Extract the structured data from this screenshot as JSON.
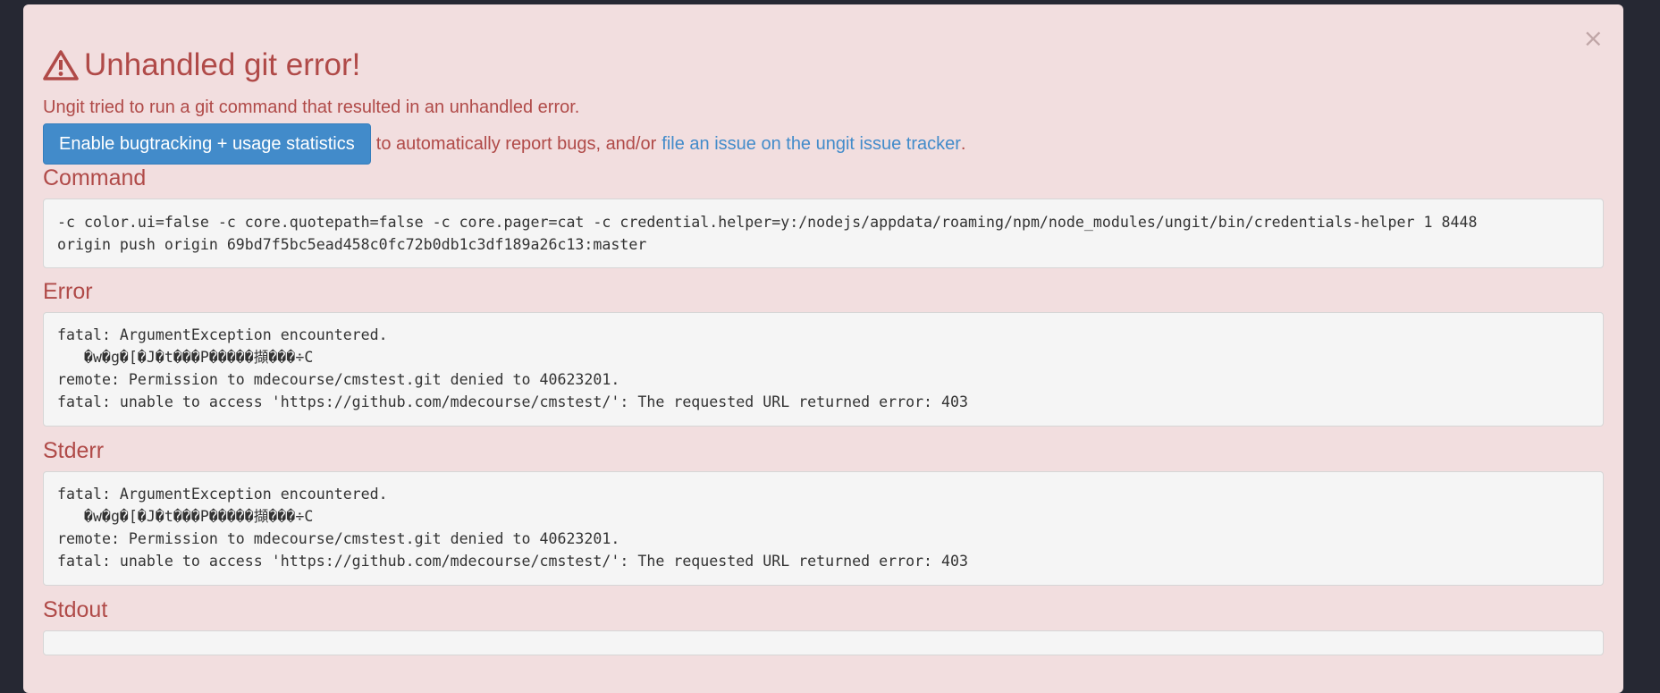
{
  "dialog": {
    "close_symbol": "×",
    "title": "Unhandled git error!",
    "title_icon": "warning-triangle-icon",
    "subtitle": "Ungit tried to run a git command that resulted in an unhandled error.",
    "enable_button_label": "Enable bugtracking + usage statistics",
    "action_text": "to automatically report bugs, and/or",
    "issue_link_label": "file an issue on the ungit issue tracker",
    "issue_link_suffix": "."
  },
  "sections": {
    "command": {
      "title": "Command",
      "content": "-c color.ui=false -c core.quotepath=false -c core.pager=cat -c credential.helper=y:/nodejs/appdata/roaming/npm/node_modules/ungit/bin/credentials-helper 1 8448\norigin push origin 69bd7f5bc5ead458c0fc72b0db1c3df189a26c13:master"
    },
    "error": {
      "title": "Error",
      "content": "fatal: ArgumentException encountered.\n   �w�g�[�J�t���P�����擷���÷C\nremote: Permission to mdecourse/cmstest.git denied to 40623201.\nfatal: unable to access 'https://github.com/mdecourse/cmstest/': The requested URL returned error: 403"
    },
    "stderr": {
      "title": "Stderr",
      "content": "fatal: ArgumentException encountered.\n   �w�g�[�J�t���P�����擷���÷C\nremote: Permission to mdecourse/cmstest.git denied to 40623201.\nfatal: unable to access 'https://github.com/mdecourse/cmstest/': The requested URL returned error: 403"
    },
    "stdout": {
      "title": "Stdout",
      "content": ""
    }
  },
  "colors": {
    "backdrop": "#262833",
    "dialog_background": "#f2dedf",
    "danger_text": "#b04a48",
    "primary_button": "#428bca",
    "link": "#428bca",
    "pre_background": "#f5f5f5"
  }
}
